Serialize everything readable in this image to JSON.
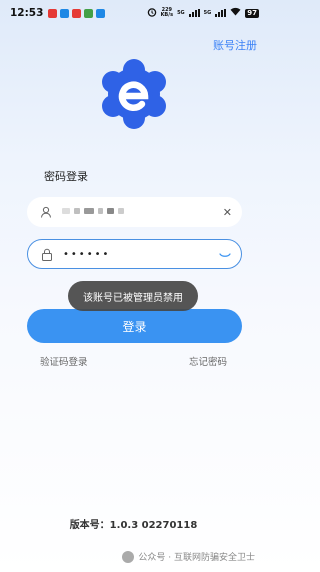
{
  "status_bar": {
    "time": "12:53",
    "net_speed_value": "229",
    "net_speed_unit": "KB/s",
    "sim1": "5G",
    "sim2": "5G",
    "battery": "97"
  },
  "header": {
    "register_link": "账号注册"
  },
  "login": {
    "title": "密码登录",
    "username_value": "",
    "password_value": "••••••",
    "submit_label": "登录",
    "sms_login_link": "验证码登录",
    "forgot_password_link": "忘记密码"
  },
  "toast": {
    "message": "该账号已被管理员禁用"
  },
  "footer": {
    "version": "版本号：1.0.3 02270118"
  },
  "watermark": {
    "text": "公众号 · 互联网防骗安全卫士"
  },
  "colors": {
    "brand_blue": "#3a93f2",
    "logo_blue": "#2f62e6",
    "link_blue": "#3b82f6"
  }
}
